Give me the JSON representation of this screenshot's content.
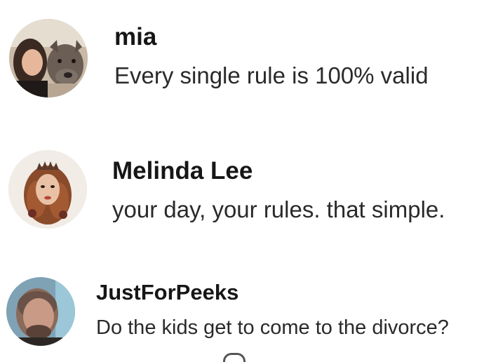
{
  "comments": [
    {
      "username": "mia",
      "text": "Every single rule is 100% valid",
      "avatar_icon": "avatar-woman-with-dog"
    },
    {
      "username": "Melinda Lee",
      "text": "your day, your rules. that simple.",
      "avatar_icon": "avatar-illustrated-queen"
    },
    {
      "username": "JustForPeeks",
      "text": "Do the kids get to come to the divorce?",
      "avatar_icon": "avatar-man-portrait"
    }
  ],
  "colors": {
    "username": "#161616",
    "text": "#2a2a2a",
    "background": "#ffffff"
  }
}
